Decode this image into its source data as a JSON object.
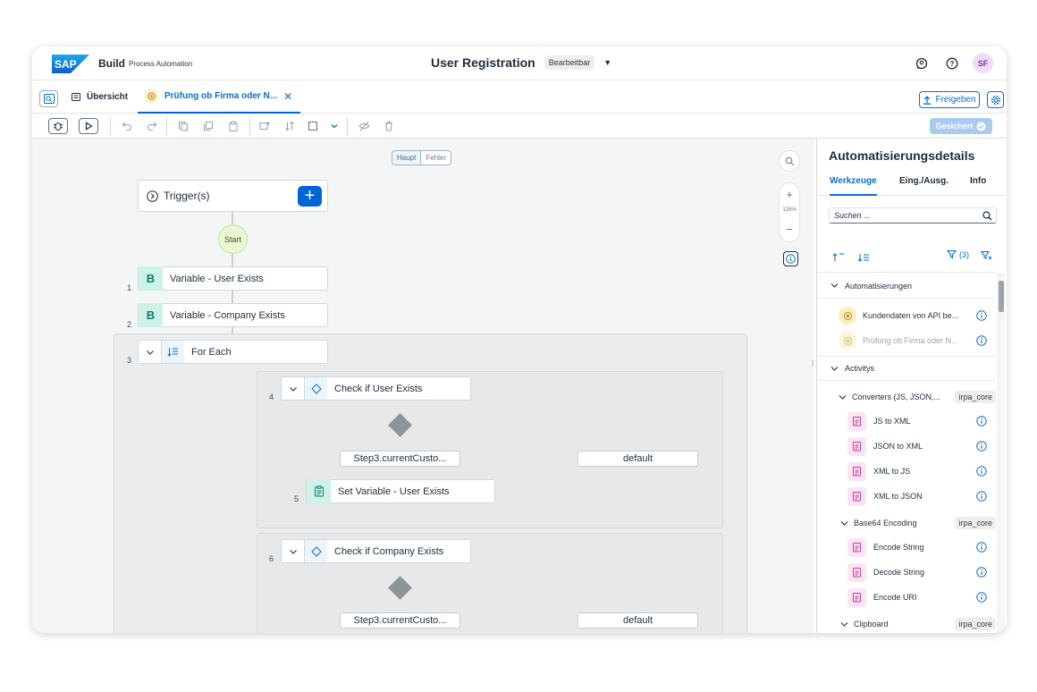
{
  "shell": {
    "logo": "SAP",
    "app_name": "Build",
    "app_sub": "Process Automation",
    "title": "User Registration",
    "status": "Bearbeitbar",
    "avatar": "SF"
  },
  "tabs": {
    "overview": "Übersicht",
    "active": "Prüfung ob Firma oder N...",
    "share": "Freigeben"
  },
  "toolbar": {
    "saved": "Gesichert"
  },
  "canvas": {
    "segment": [
      "Haupt",
      "Fehler"
    ],
    "zoom_label": "120%",
    "trigger": "Trigger(s)",
    "start": "Start",
    "steps": [
      {
        "num": "1",
        "badge": "B",
        "label": "Variable - User Exists"
      },
      {
        "num": "2",
        "badge": "B",
        "label": "Variable - Company Exists"
      },
      {
        "num": "3",
        "label": "For Each"
      },
      {
        "num": "4",
        "label": "Check if User Exists"
      },
      {
        "num": "5",
        "label": "Set Variable - User Exists"
      },
      {
        "num": "6",
        "label": "Check if Company Exists"
      }
    ],
    "branches": {
      "b1_left": "Step3.currentCusto...",
      "b1_right": "default",
      "b2_left": "Step3.currentCusto...",
      "b2_right": "default"
    }
  },
  "panel": {
    "title": "Automatisierungsdetails",
    "tabs": [
      "Werkzeuge",
      "Eing./Ausg.",
      "Info"
    ],
    "search_placeholder": "Suchen ...",
    "filter_count": "(3)",
    "sections": {
      "automations": "Automatisierungen",
      "automation_items": [
        "Kundendaten von API be...",
        "Prüfung ob Firma oder N..."
      ],
      "activities": "Activitys",
      "converters": "Converters (JS, JSON,...",
      "converters_tag": "irpa_core",
      "converter_items": [
        "JS to XML",
        "JSON to XML",
        "XML to JS",
        "XML to JSON"
      ],
      "base64": "Base64 Encoding",
      "base64_tag": "irpa_core",
      "base64_items": [
        "Encode String",
        "Decode String",
        "Encode URI"
      ],
      "clipboard": "Clipboard",
      "clipboard_tag": "irpa_core"
    }
  },
  "colors": {
    "accent": "#0a6ed1",
    "primary_button": "#0064d9",
    "variable_badge": "#cdf2ea",
    "activity_icon": "#fce4f3",
    "automation_icon": "#fdeebb"
  }
}
